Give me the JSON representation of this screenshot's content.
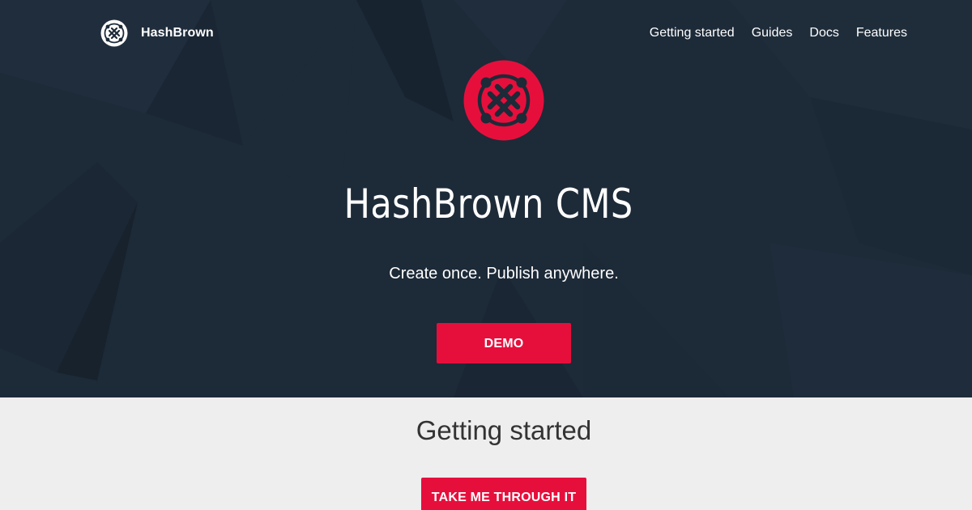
{
  "header": {
    "brand_name": "HashBrown",
    "nav": [
      {
        "label": "Getting started"
      },
      {
        "label": "Guides"
      },
      {
        "label": "Docs"
      },
      {
        "label": "Features"
      }
    ]
  },
  "hero": {
    "title": "HashBrown CMS",
    "tagline": "Create once. Publish anywhere.",
    "demo_button": "DEMO",
    "logo_icon": "hashbrown-logo-icon"
  },
  "getting_started": {
    "title": "Getting started",
    "button": "TAKE ME THROUGH IT"
  },
  "colors": {
    "hero_background": "#1d2a38",
    "accent": "#e60f3c",
    "section_background": "#eeeeee",
    "section_text": "#333333"
  }
}
